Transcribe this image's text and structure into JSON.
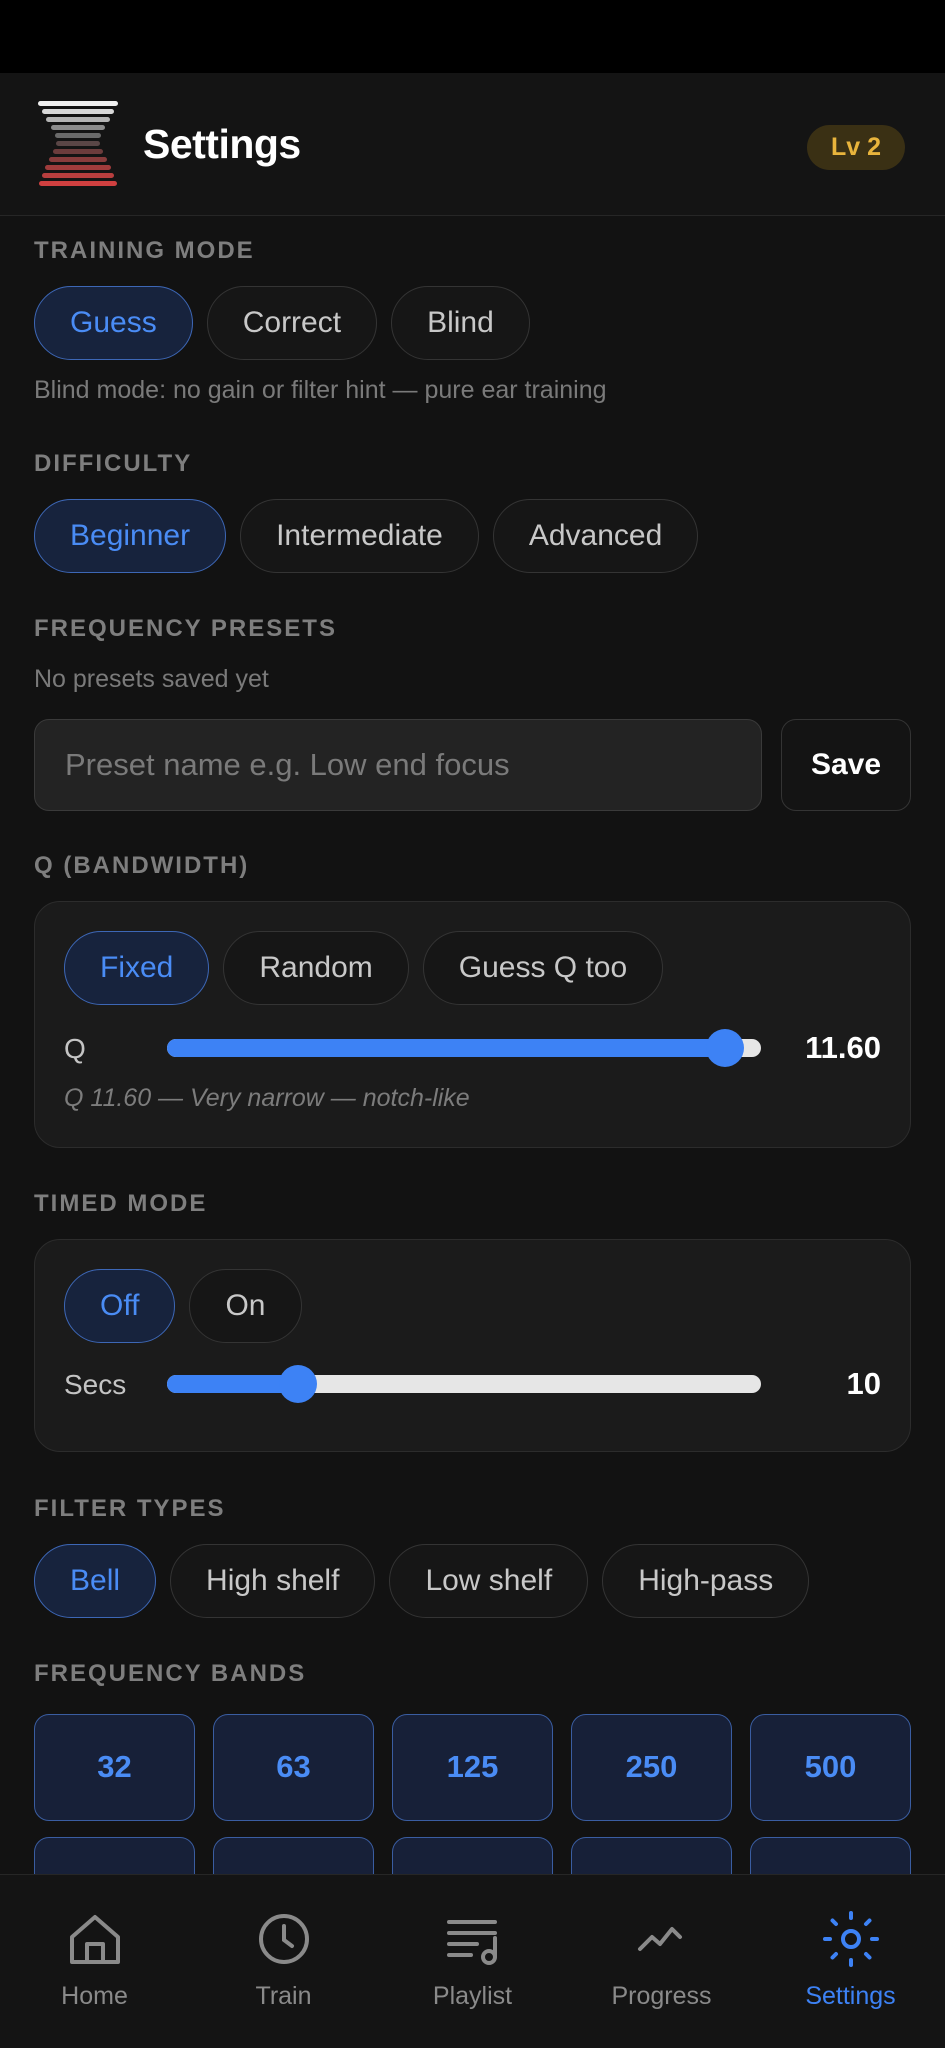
{
  "header": {
    "title": "Settings",
    "level_badge": "Lv 2"
  },
  "training_mode": {
    "label": "TRAINING MODE",
    "options": [
      "Guess",
      "Correct",
      "Blind"
    ],
    "selected": "Guess",
    "hint": "Blind mode: no gain or filter hint — pure ear training"
  },
  "difficulty": {
    "label": "DIFFICULTY",
    "options": [
      "Beginner",
      "Intermediate",
      "Advanced"
    ],
    "selected": "Beginner"
  },
  "frequency_presets": {
    "label": "FREQUENCY PRESETS",
    "empty_text": "No presets saved yet",
    "input_placeholder": "Preset name e.g. Low end focus",
    "input_value": "",
    "save_label": "Save"
  },
  "q_bandwidth": {
    "label": "Q (BANDWIDTH)",
    "options": [
      "Fixed",
      "Random",
      "Guess Q too"
    ],
    "selected": "Fixed",
    "slider_label": "Q",
    "value_text": "11.60",
    "slider_fraction": 0.94,
    "description": "Q 11.60 — Very narrow — notch-like"
  },
  "timed_mode": {
    "label": "TIMED MODE",
    "options": [
      "Off",
      "On"
    ],
    "selected": "Off",
    "slider_label": "Secs",
    "value_text": "10",
    "slider_fraction": 0.22
  },
  "filter_types": {
    "label": "FILTER TYPES",
    "options": [
      "Bell",
      "High shelf",
      "Low shelf",
      "High-pass"
    ],
    "selected": "Bell"
  },
  "frequency_bands": {
    "label": "FREQUENCY BANDS",
    "bands": [
      "32",
      "63",
      "125",
      "250",
      "500"
    ]
  },
  "bottom_nav": {
    "items": [
      {
        "label": "Home",
        "icon": "home-icon"
      },
      {
        "label": "Train",
        "icon": "clock-icon"
      },
      {
        "label": "Playlist",
        "icon": "playlist-icon"
      },
      {
        "label": "Progress",
        "icon": "trend-icon"
      },
      {
        "label": "Settings",
        "icon": "gear-icon"
      }
    ],
    "active": "Settings"
  },
  "colors": {
    "accent": "#3d82f5",
    "badge_text": "#e8b43c",
    "background": "#121212",
    "logo_top": "#f0f0f0",
    "logo_bottom": "#d04040"
  }
}
